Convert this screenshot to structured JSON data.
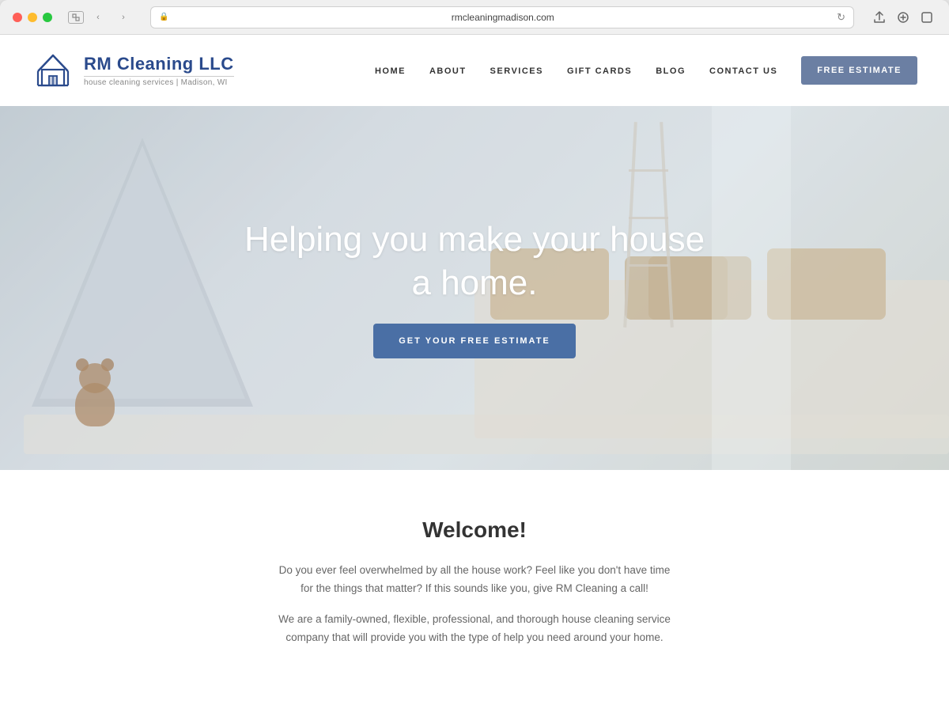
{
  "browser": {
    "url": "rmcleaningmadison.com",
    "traffic_lights": [
      "red",
      "yellow",
      "green"
    ]
  },
  "navbar": {
    "logo_name": "RM Cleaning LLC",
    "logo_tagline": "house cleaning services | Madison, WI",
    "nav_items": [
      {
        "label": "HOME",
        "active": true
      },
      {
        "label": "ABOUT",
        "active": false
      },
      {
        "label": "SERVICES",
        "active": false
      },
      {
        "label": "GIFT CARDS",
        "active": false
      },
      {
        "label": "BLOG",
        "active": false
      },
      {
        "label": "CONTACT US",
        "active": false
      }
    ],
    "cta_button": "FREE ESTIMATE"
  },
  "hero": {
    "title_line1": "Helping you make your house",
    "title_line2": "a home.",
    "cta_button": "GET YOUR FREE ESTIMATE"
  },
  "welcome": {
    "title": "Welcome!",
    "paragraph1": "Do you ever feel overwhelmed by all the house work? Feel like you don't have time for the things that matter? If this sounds like you, give RM Cleaning a call!",
    "paragraph2": "We are a family-owned, flexible, professional, and thorough house cleaning service company that will provide you with the type of help you need around your home."
  }
}
